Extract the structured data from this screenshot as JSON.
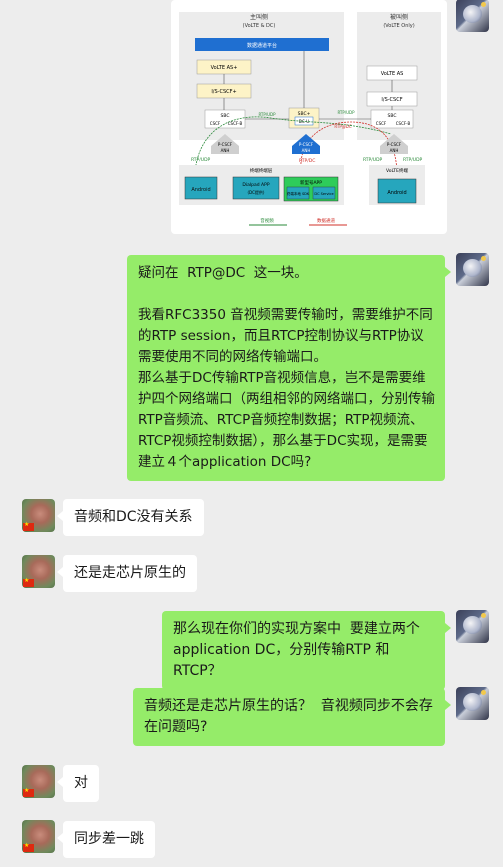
{
  "diagram": {
    "left_title": "主叫侧",
    "left_subtitle": "(VoLTE & DC)",
    "right_title": "被叫侧",
    "right_subtitle": "(VoLTE Only)",
    "bar_label": "数据通道平台",
    "volte_as_left": "VoLTE AS+",
    "icscf_left": "I/S-CSCF+",
    "sbc_left": "SBC",
    "sbc_left_sub1": "CSCF",
    "sbc_left_sub2": "CSCF-B",
    "sbc_mid": "SBC+",
    "sbc_mid_sub": "DC-U",
    "volte_as_right": "VoLTE AS",
    "icscf_right": "I/S-CSCF",
    "sbc_right": "SBC",
    "sbc_right_sub1": "CSCF",
    "sbc_right_sub2": "CSCF-B",
    "rtp_udp_1": "RTP/UDP",
    "rtp_udp_2": "RTP/UDP",
    "rtp_udp_3": "RTP/UDP",
    "rtp_udp_4": "RTP/UDP",
    "rtp_udp_5": "RTP/UDP",
    "rtp_dc": "RTP/DC",
    "rtp_dc_2": "RTP@DC",
    "pcscf_left": "P-CSCF",
    "pcscf_left_sub": "ANH",
    "pcscf_mid": "P-CSCF",
    "pcscf_mid_sub": "ANH",
    "pcscf_right": "P-CSCF",
    "pcscf_right_sub": "ANH",
    "terminal_label": "终端终端层",
    "android_left": "Android",
    "dialpad_app": "Dialpad APP",
    "dialpad_sub": "(DC提供)",
    "new_app": "新型号APP",
    "new_app_sub1": "终端本地 SDK",
    "new_app_sub2": "DC Service",
    "volte_right": "VoLTE终端",
    "android_right": "Android",
    "legend_green": "音视频",
    "legend_red": "数据通道"
  },
  "messages": [
    {
      "id": 1,
      "side": "out",
      "text": "疑问在  RTP@DC  这一块。\n\n我看RFC3350 音视频需要传输时，需要维护不同的RTP session，而且RTCP控制协议与RTP协议需要使用不同的网络传输端口。\n那么基于DC传输RTP音视频信息，岂不是需要维护四个网络端口（两组相邻的网络端口，分别传输RTP音频流、RTCP音频控制数据；RTP视频流、RTCP视频控制数据），那么基于DC实现，是需要建立４个application DC吗?"
    },
    {
      "id": 2,
      "side": "in",
      "text": "音频和DC没有关系"
    },
    {
      "id": 3,
      "side": "in",
      "text": "还是走芯片原生的"
    },
    {
      "id": 4,
      "side": "out",
      "text": "那么现在你们的实现方案中  要建立两个application DC，分别传输RTP 和RTCP？"
    },
    {
      "id": 5,
      "side": "out",
      "text": "音频还是走芯片原生的话？  音视频同步不会存在问题吗?"
    },
    {
      "id": 6,
      "side": "in",
      "text": "对"
    },
    {
      "id": 7,
      "side": "in",
      "text": "同步差一跳"
    }
  ]
}
